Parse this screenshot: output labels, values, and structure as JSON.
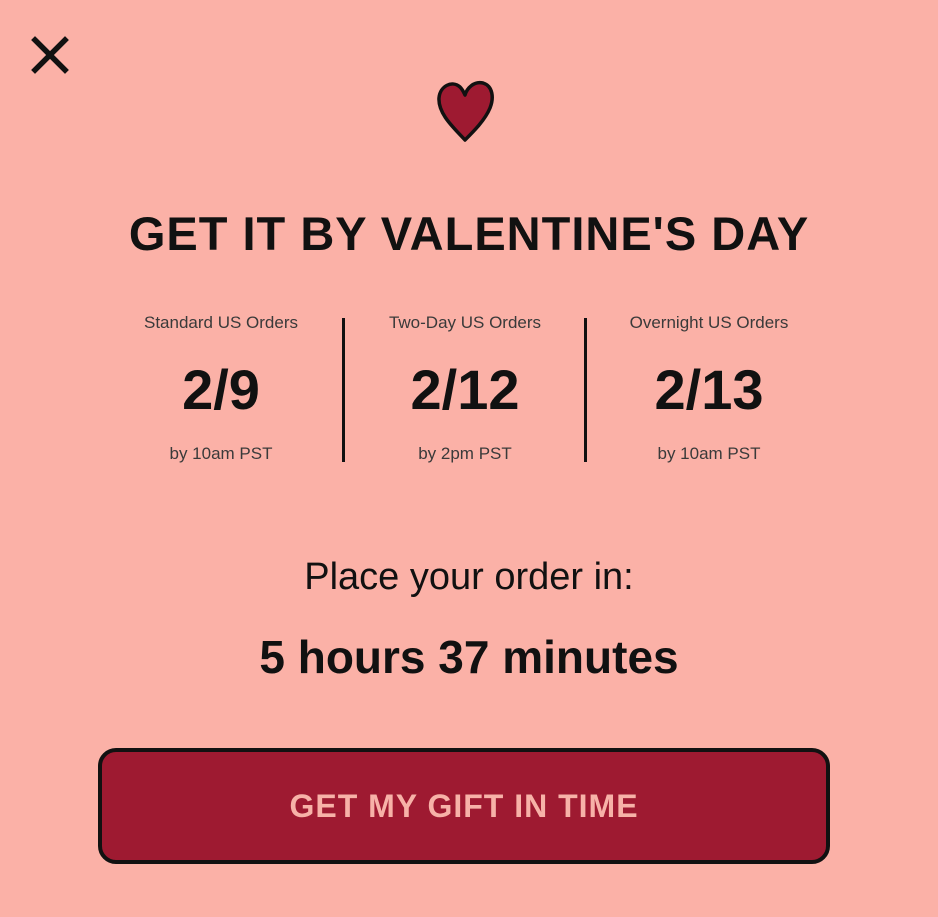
{
  "colors": {
    "background": "#fbb1a7",
    "accent": "#9e1a31",
    "button_text": "#f7b2a8",
    "text": "#111111"
  },
  "icons": {
    "close": "close-icon",
    "heart": "heart-icon"
  },
  "modal": {
    "title": "GET IT BY VALENTINE'S DAY",
    "shipping": [
      {
        "label": "Standard US Orders",
        "date": "2/9",
        "cutoff": "by 10am PST"
      },
      {
        "label": "Two-Day US Orders",
        "date": "2/12",
        "cutoff": "by 2pm PST"
      },
      {
        "label": "Overnight US Orders",
        "date": "2/13",
        "cutoff": "by 10am PST"
      }
    ],
    "place_order_label": "Place your order in:",
    "countdown": "5 hours 37 minutes",
    "cta_label": "GET MY GIFT IN TIME"
  }
}
